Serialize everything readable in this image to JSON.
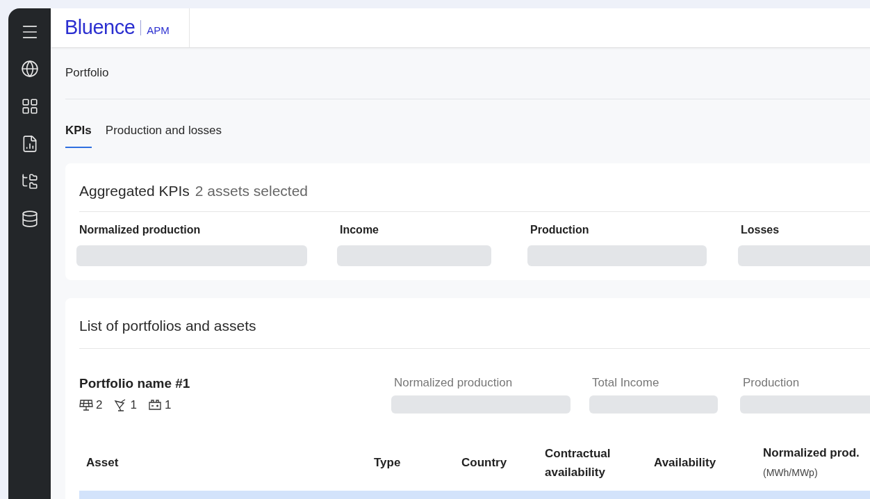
{
  "header": {
    "logo": "Bluence",
    "product": "APM"
  },
  "sidebar": {
    "items": [
      {
        "kind": "globe"
      },
      {
        "kind": "grid"
      },
      {
        "kind": "report"
      },
      {
        "kind": "tree"
      },
      {
        "kind": "database"
      }
    ]
  },
  "page": {
    "title": "Portfolio"
  },
  "tabs": [
    {
      "label": "KPIs",
      "selected": true
    },
    {
      "label": "Production and losses",
      "selected": false
    }
  ],
  "kpis": {
    "title": "Aggregated KPIs",
    "subtitle": "2 assets selected",
    "labels": [
      "Normalized production",
      "Income",
      "Production",
      "Losses"
    ]
  },
  "portfolios": {
    "title": "List of portfolios and assets",
    "portfolio": {
      "name": "Portfolio name #1",
      "counts": [
        {
          "kind": "solar",
          "count": "2"
        },
        {
          "kind": "dish",
          "count": "1"
        },
        {
          "kind": "battery",
          "count": "1"
        }
      ],
      "metrics": [
        "Normalized production",
        "Total Income",
        "Production"
      ]
    },
    "table": {
      "columns": [
        {
          "label": "Asset"
        },
        {
          "label": "Type"
        },
        {
          "label": "Country"
        },
        {
          "label": "Contractual availability"
        },
        {
          "label": "Availability"
        },
        {
          "label": "Normalized prod.",
          "unit": "(MWh/MWp)"
        }
      ]
    }
  }
}
